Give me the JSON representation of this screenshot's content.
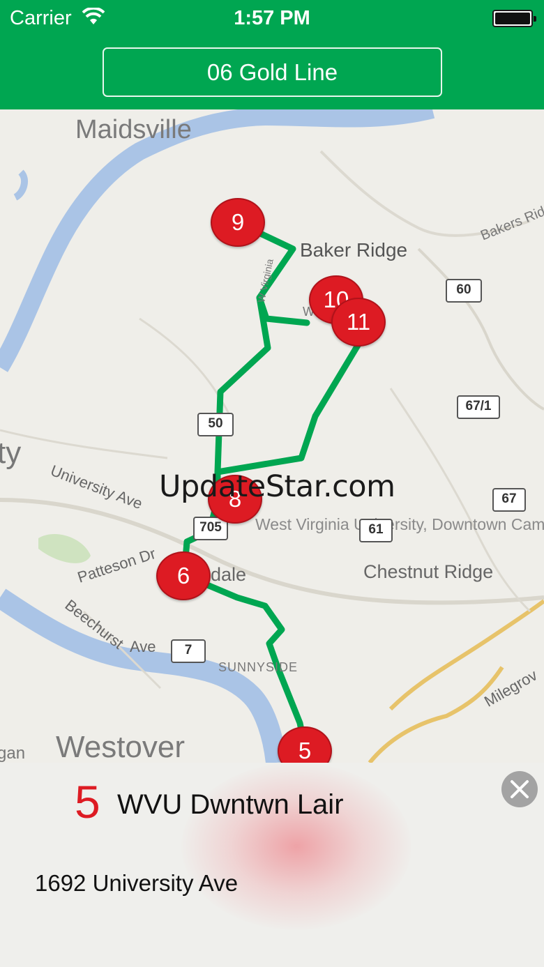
{
  "status_bar": {
    "carrier": "Carrier",
    "time": "1:57 PM",
    "icons": [
      "wifi-icon",
      "battery-icon"
    ]
  },
  "header": {
    "route_label": "06 Gold Line",
    "background_color": "#00a651"
  },
  "map": {
    "place_labels": {
      "maidsville": "Maidsville",
      "baker_ridge": "Baker Ridge",
      "bakers_ridge_rd": "Bakers Rid",
      "city_fragment": "ty",
      "university_ave": "University Ave",
      "patteson_dr": "Patteson Dr",
      "beechurst": "Beechurst",
      "ave": "Ave",
      "wvu_campus": "West Virginia University, Downtown Campus",
      "chestnut_ridge": "Chestnut Ridge",
      "dale": "dale",
      "sunnyside": "SUNNYSIDE",
      "westover": "Westover",
      "gan": "gan",
      "milegrove": "Milegrov",
      "west_v": "W Virginia",
      "we": "We"
    },
    "route_shields": {
      "r60": "60",
      "r67_1": "67/1",
      "r50": "50",
      "r67": "67",
      "r61": "61",
      "r705": "705",
      "r7": "7"
    },
    "stops": {
      "s9": "9",
      "s10": "10",
      "s11": "11",
      "s8": "8",
      "s6": "6",
      "s5": "5"
    },
    "route_color": "#00a651",
    "marker_color": "#dd1b23",
    "watermark": "UpdateStar.com"
  },
  "selected_stop": {
    "number": "5",
    "name": "WVU Dwntwn Lair",
    "address": "1692 University Ave",
    "close_icon": "close-icon"
  }
}
